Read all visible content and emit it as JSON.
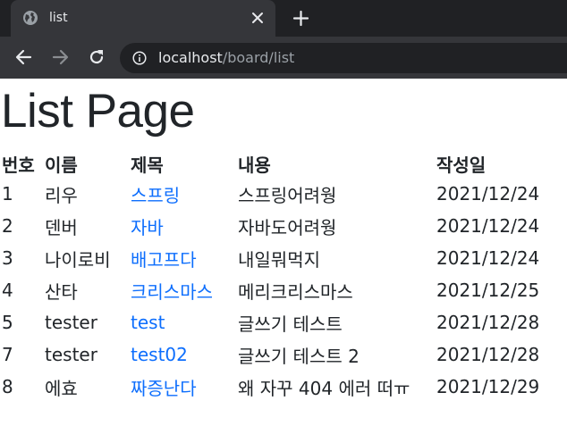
{
  "browser": {
    "tab_title": "list",
    "url_host": "localhost",
    "url_path": "/board/list"
  },
  "page": {
    "title": "List Page"
  },
  "table": {
    "headers": {
      "no": "번호",
      "name": "이름",
      "title": "제목",
      "content": "내용",
      "date": "작성일"
    },
    "rows": [
      {
        "no": "1",
        "name": "리우",
        "title": "스프링",
        "content": "스프링어려웡",
        "date": "2021/12/24"
      },
      {
        "no": "2",
        "name": "덴버",
        "title": "자바",
        "content": "자바도어려웡",
        "date": "2021/12/24"
      },
      {
        "no": "3",
        "name": "나이로비",
        "title": "배고프다",
        "content": "내일뭐먹지",
        "date": "2021/12/24"
      },
      {
        "no": "4",
        "name": "산타",
        "title": "크리스마스",
        "content": "메리크리스마스",
        "date": "2021/12/25"
      },
      {
        "no": "5",
        "name": "tester",
        "title": "test",
        "content": "글쓰기 테스트",
        "date": "2021/12/28"
      },
      {
        "no": "7",
        "name": "tester",
        "title": "test02",
        "content": "글쓰기 테스트 2",
        "date": "2021/12/28"
      },
      {
        "no": "8",
        "name": "에효",
        "title": "짜증난다",
        "content": "왜 자꾸 404 에러 떠ㅠ",
        "date": "2021/12/29"
      }
    ]
  },
  "colors": {
    "tabstrip": "#202124",
    "toolbar": "#35363a",
    "link": "#0d6efd",
    "text": "#212529"
  }
}
